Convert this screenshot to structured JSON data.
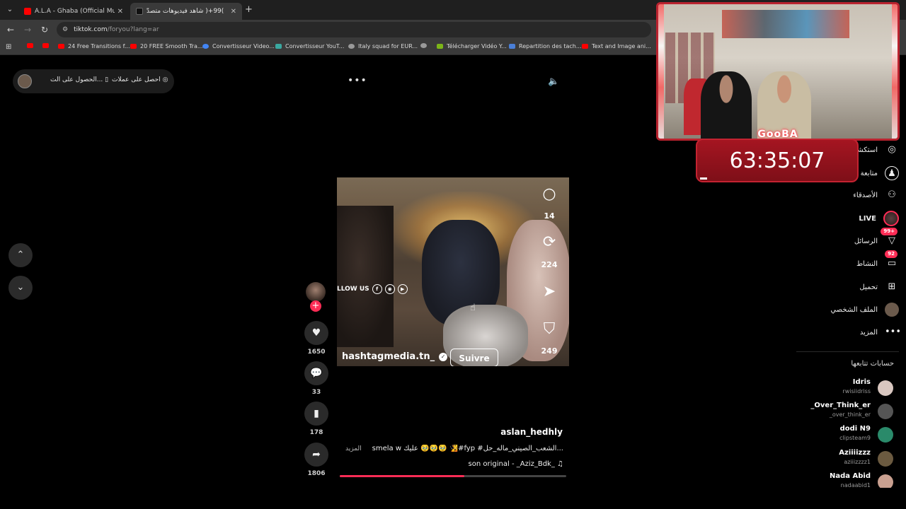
{
  "browser": {
    "tabs": [
      {
        "title": "A.L.A - Ghaba (Official Music Vi",
        "favicon_color": "#ff0000",
        "active": false
      },
      {
        "title": ")99+( شاهد فيديوهات متصدّ",
        "favicon_color": "#222222",
        "active": true
      }
    ],
    "tabs_menu_icon": "chevron-down-icon",
    "close_glyph": "✕",
    "new_tab_glyph": "+",
    "url_host": "tiktok.com",
    "url_path": "/foryou?lang=ar",
    "bookmarks": [
      {
        "label": "",
        "color": "#ff0000"
      },
      {
        "label": "",
        "color": "#ff0000"
      },
      {
        "label": "24 Free Transitions f...",
        "color": "#ff0000"
      },
      {
        "label": "20 FREE Smooth Tra...",
        "color": "#ff0000"
      },
      {
        "label": "Convertisseur Video...",
        "color": "#4285f4"
      },
      {
        "label": "Convertisseur YouT...",
        "color": "#3aa8a0"
      },
      {
        "label": "Italy squad for EUR...",
        "color": "#999999"
      },
      {
        "label": "",
        "color": "#999999"
      },
      {
        "label": "Télécharger Vidéo Y...",
        "color": "#7cb518"
      },
      {
        "label": "Repartition des tach...",
        "color": "#4a7fd8"
      },
      {
        "label": "Text and Image ani...",
        "color": "#ff0000"
      }
    ]
  },
  "topbar": {
    "get_app": "الحصول على الت...",
    "get_coins": "احصل على عملات",
    "more_glyph": "•••",
    "speaker_glyph": "🔈"
  },
  "video": {
    "follow_us": "LLOW US",
    "author_handle": "hashtagmedia.tn_",
    "follow_button": "Suivre",
    "overlay_counts": {
      "comments": "14",
      "reposts": "224",
      "saves": "249"
    },
    "progress": 0.55
  },
  "actions": {
    "likes": "1650",
    "comments": "33",
    "saves": "178",
    "shares": "1806"
  },
  "caption": {
    "author": "aslan_hedhly",
    "text": "smela w عليك 🥹🥹🥹 🧏#fyp #الشعب_الصيني_ماله_حل...",
    "more": "المزيد",
    "sound": "son original - _Aziz_Bdk_ ♫"
  },
  "sidebar": {
    "nav": [
      {
        "label": "استكشف",
        "icon": "compass-icon"
      },
      {
        "label": "متابعة",
        "icon": "following-icon"
      },
      {
        "label": "الأصدقاء",
        "icon": "friends-icon"
      },
      {
        "label": "LIVE",
        "icon": "live-icon"
      },
      {
        "label": "الرسائل",
        "icon": "messages-icon",
        "badge": "99+"
      },
      {
        "label": "النشاط",
        "icon": "activity-icon",
        "badge": "92"
      },
      {
        "label": "تحميل",
        "icon": "upload-icon"
      },
      {
        "label": "الملف الشخصي",
        "icon": "profile-icon"
      },
      {
        "label": "المزيد",
        "icon": "more-icon"
      }
    ],
    "following_title": "حسابات تتابعها",
    "accounts": [
      {
        "name": "Idris",
        "handle": "rwisiidriss",
        "color": "#d9c7c0"
      },
      {
        "name": "_Over_Think_er",
        "handle": "_over_think_er",
        "color": "#555555"
      },
      {
        "name": "dodi N9",
        "handle": "clipsteam9",
        "color": "#2a8a6a"
      },
      {
        "name": "Aziiiizzz",
        "handle": "aziiizzzz1",
        "color": "#6b5a40"
      },
      {
        "name": "Nada Abid",
        "handle": "nadaabid1",
        "color": "#c9a090"
      }
    ]
  },
  "overlay": {
    "brand": "GooBA",
    "timer": "63:35:07"
  },
  "accent": "#fe2c55"
}
